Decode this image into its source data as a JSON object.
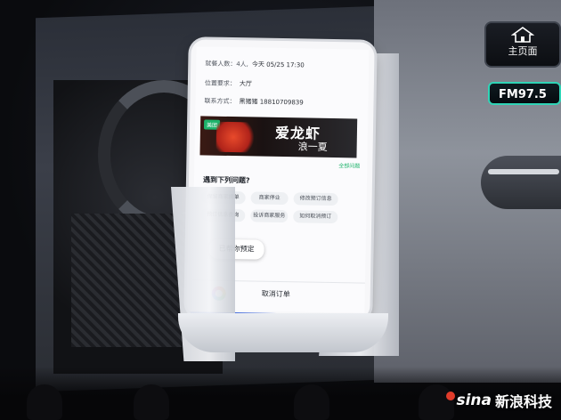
{
  "car": {
    "home_label": "主页面",
    "radio_label": "FM97.5"
  },
  "booking": {
    "row1": {
      "label": "就餐人数：4人,",
      "value": "今天 05/25 17:30"
    },
    "row2": {
      "label": "位置要求：",
      "value": "大厅"
    },
    "row3": {
      "label": "联系方式：",
      "value": "黑猪猪 18810709839"
    }
  },
  "banner": {
    "badge": "美团",
    "title": "爱龙虾",
    "subtitle": "浪一夏"
  },
  "all_questions_link": "全部问题",
  "question_title": "遇到下列问题?",
  "chips": [
    {
      "label": "保留商家摘单"
    },
    {
      "label": "商家停业"
    },
    {
      "label": "修改预订信息"
    },
    {
      "label": "预订信息查询"
    },
    {
      "label": "投诉商家服务"
    },
    {
      "label": "如何取消预订"
    }
  ],
  "assistant_message": "已帮你预定",
  "cancel_button": "取消订单",
  "watermark": {
    "logo": "sina",
    "text": "新浪科技"
  }
}
